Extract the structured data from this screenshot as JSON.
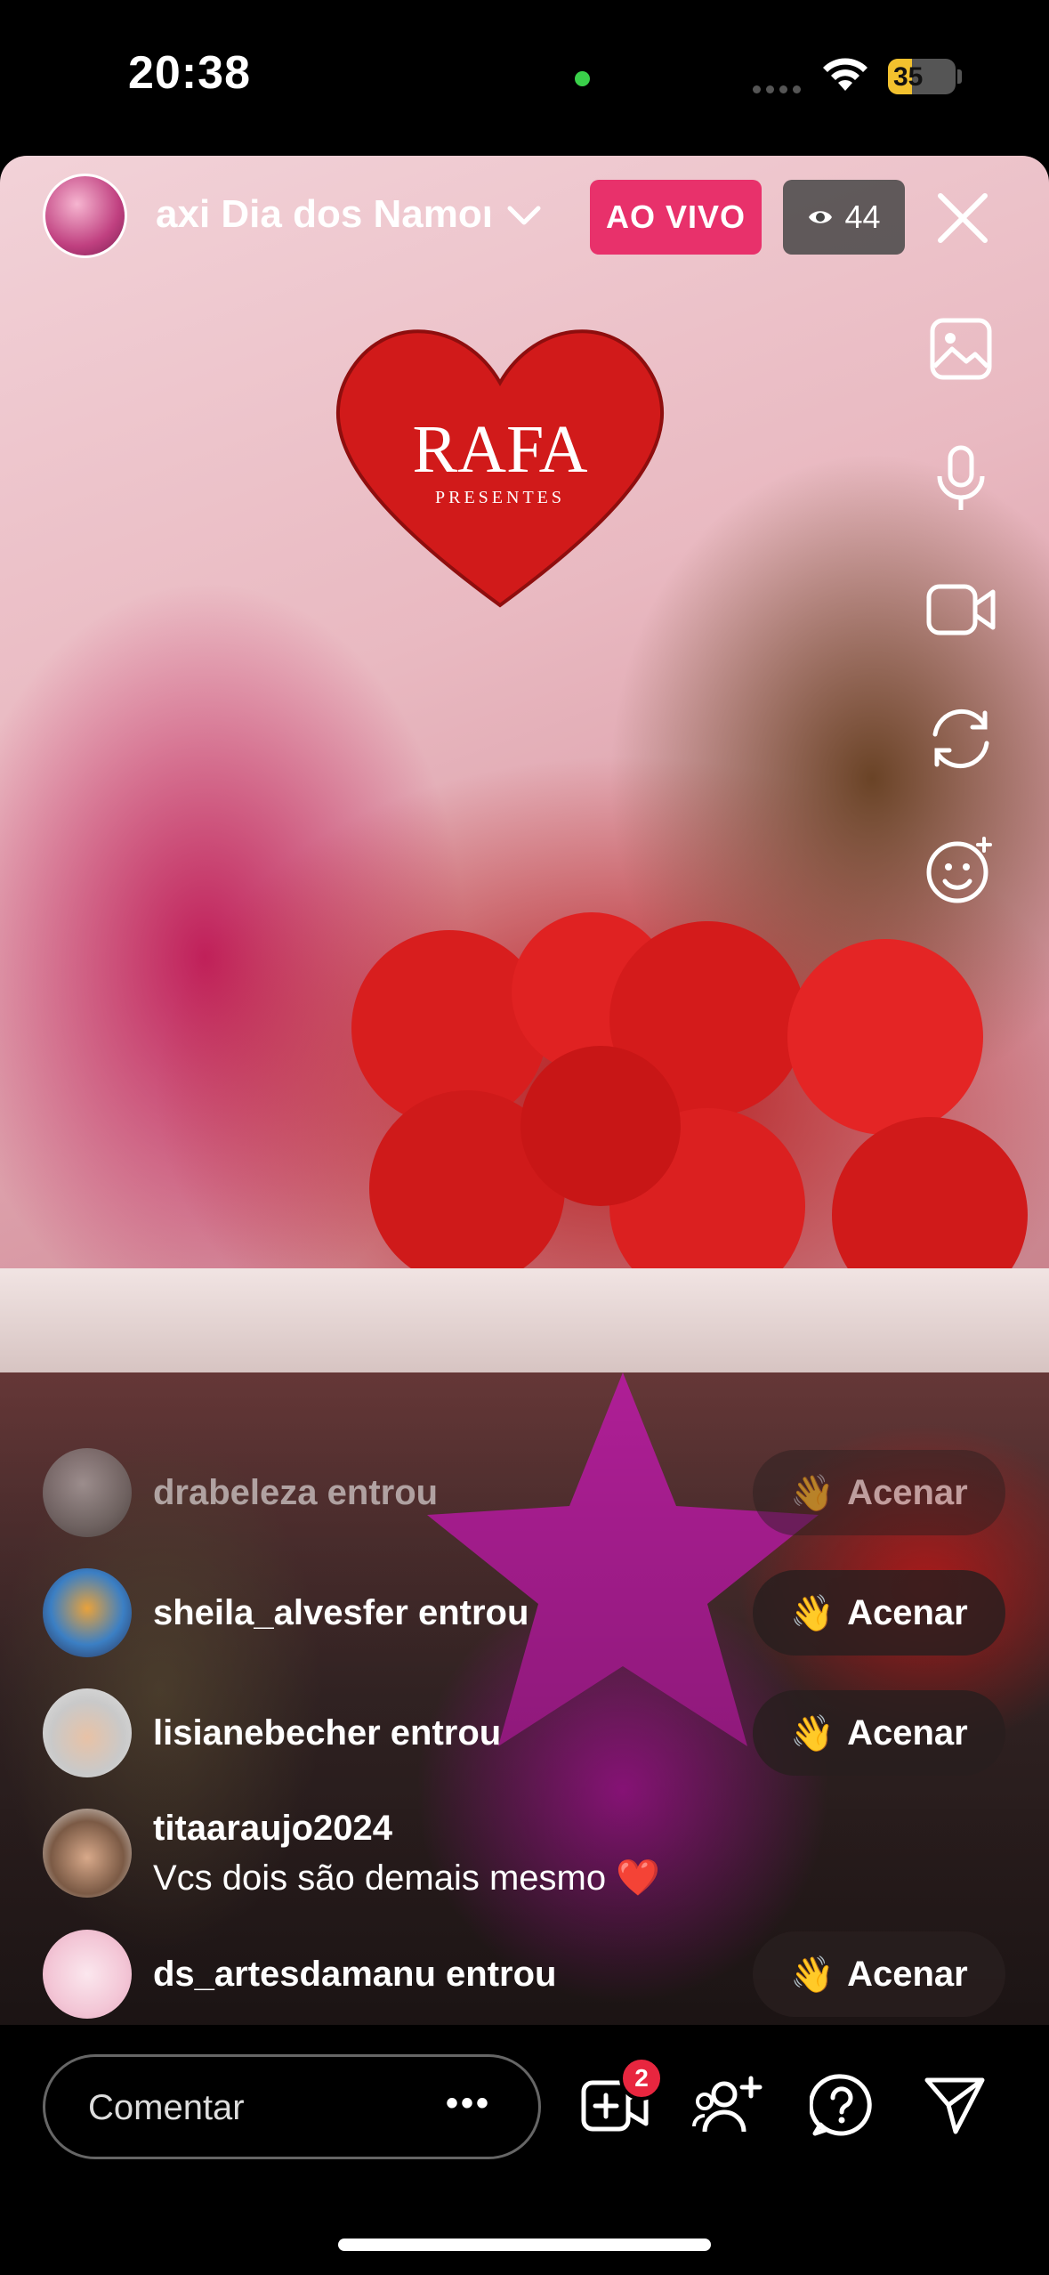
{
  "status_bar": {
    "time": "20:38",
    "battery_level": "35",
    "battery_fraction": 0.35
  },
  "live": {
    "title": "axi Dia dos Namorados",
    "badge": "AO VIVO",
    "viewer_count": "44"
  },
  "video_overlay": {
    "balloon_brand": "RAFA",
    "balloon_brand_sub": "PRESENTES"
  },
  "comments": [
    {
      "username": "drabeleza",
      "text": "drabeleza entrou",
      "action": "Acenar",
      "faded": true
    },
    {
      "username": "sheila_alvesfer",
      "text": "sheila_alvesfer entrou",
      "action": "Acenar"
    },
    {
      "username": "lisianebecher",
      "text": "lisianebecher entrou",
      "action": "Acenar"
    },
    {
      "username": "titaaraujo2024",
      "message": "Vcs dois são demais mesmo ❤️"
    },
    {
      "username": "ds_artesdamanu",
      "text": "ds_artesdamanu entrou",
      "action": "Acenar"
    }
  ],
  "comment_bar": {
    "placeholder": "Comentar",
    "more": "•••"
  },
  "requests_badge": "2",
  "icons": [
    "close-icon",
    "gallery-icon",
    "mic-icon",
    "camera-icon",
    "flip-camera-icon",
    "effects-icon",
    "add-guest-icon",
    "invite-icon",
    "question-icon",
    "send-icon"
  ]
}
